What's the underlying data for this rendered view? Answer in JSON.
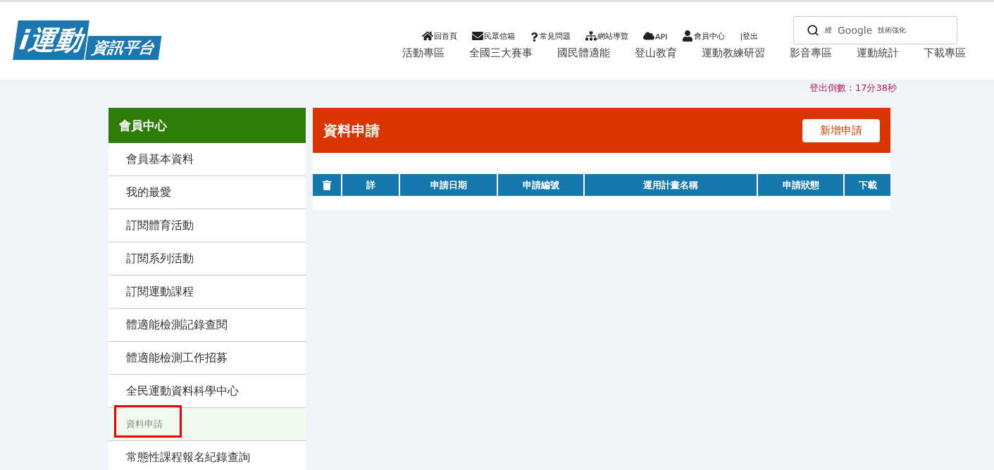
{
  "logo": {
    "main": "i運動",
    "sub": "資訊平台"
  },
  "top_links": [
    {
      "kind": "home",
      "label": "回首頁"
    },
    {
      "kind": "mail",
      "label": "民眾信箱"
    },
    {
      "kind": "help",
      "label": "常見問題"
    },
    {
      "kind": "sitemap",
      "label": "網站導覽"
    },
    {
      "kind": "cloud",
      "label": "API"
    },
    {
      "kind": "user",
      "label": "會員中心"
    },
    {
      "kind": "plain",
      "label": "|登出"
    }
  ],
  "search": {
    "prefix": "經",
    "brand": "Google",
    "suffix": "技術強化"
  },
  "nav": [
    "活動專區",
    "全國三大賽事",
    "國民體適能",
    "登山教育",
    "運動教練研習",
    "影音專區",
    "運動統計",
    "下載專區"
  ],
  "countdown": "登出倒數：17分38秒",
  "sidebar": {
    "title": "會員中心",
    "items": [
      {
        "label": "會員基本資料",
        "selected": false,
        "outlined": false
      },
      {
        "label": "我的最愛",
        "selected": false,
        "outlined": false
      },
      {
        "label": "訂閱體育活動",
        "selected": false,
        "outlined": false
      },
      {
        "label": "訂閱系列活動",
        "selected": false,
        "outlined": false
      },
      {
        "label": "訂閱運動課程",
        "selected": false,
        "outlined": false
      },
      {
        "label": "體適能檢測記錄查閱",
        "selected": false,
        "outlined": false
      },
      {
        "label": "體適能檢測工作招募",
        "selected": false,
        "outlined": false
      },
      {
        "label": "全民運動資料科學中心",
        "selected": false,
        "outlined": false
      },
      {
        "label": "資料申請",
        "selected": true,
        "outlined": true
      },
      {
        "label": "常態性課程報名紀錄查詢",
        "selected": false,
        "outlined": false
      }
    ]
  },
  "panel": {
    "title": "資料申請",
    "button": "新增申請"
  },
  "table": {
    "columns": [
      {
        "kind": "trash"
      },
      {
        "kind": "text",
        "label": "詳"
      },
      {
        "kind": "text",
        "label": "申請日期"
      },
      {
        "kind": "text",
        "label": "申請編號"
      },
      {
        "kind": "text",
        "label": "運用計畫名稱"
      },
      {
        "kind": "text",
        "label": "申請狀態"
      },
      {
        "kind": "text",
        "label": "下載"
      }
    ]
  }
}
